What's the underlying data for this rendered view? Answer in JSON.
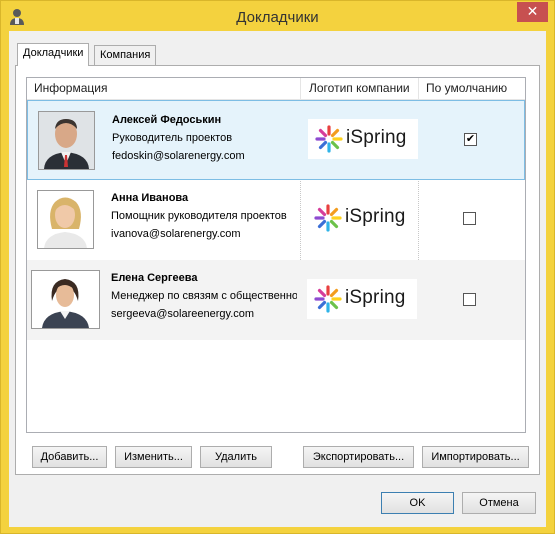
{
  "window": {
    "title": "Докладчики",
    "close_glyph": "✕"
  },
  "tabs": [
    {
      "label": "Докладчики",
      "active": true
    },
    {
      "label": "Компания",
      "active": false
    }
  ],
  "list": {
    "columns": [
      "Информация",
      "Логотип компании",
      "По умолчанию"
    ],
    "rows": [
      {
        "name": "Алексей Федоськин",
        "role": "Руководитель проектов",
        "email": "fedoskin@solarenergy.com",
        "logo_text": "iSpring",
        "default": true,
        "check_glyph": "✔"
      },
      {
        "name": "Анна Иванова",
        "role": "Помощник руководителя проектов",
        "email": "ivanova@solarenergy.com",
        "logo_text": "iSpring",
        "default": false,
        "check_glyph": ""
      },
      {
        "name": "Елена Сергеева",
        "role": "Менеджер по связям с общественностью",
        "email": "sergeeva@solareenergy.com",
        "logo_text": "iSpring",
        "default": false,
        "check_glyph": ""
      }
    ]
  },
  "buttons": {
    "add": "Добавить...",
    "edit": "Изменить...",
    "delete": "Удалить",
    "export": "Экспортировать...",
    "import": "Импортировать...",
    "ok": "OK",
    "cancel": "Отмена"
  },
  "icons": {
    "app": "presenter-icon",
    "logo_mark": "ispring-burst-icon",
    "check": "checkmark-icon"
  },
  "colors": {
    "title_bar": "#f4d23e",
    "close_button": "#c75050",
    "selection": "#e5f3fb",
    "selection_border": "#7dbde4",
    "logo_rays": [
      "#e8403f",
      "#f39c1e",
      "#ffd21f",
      "#6cc24a",
      "#2fb3e8",
      "#3b6fd6",
      "#8e4bd1",
      "#d63d9b"
    ]
  }
}
